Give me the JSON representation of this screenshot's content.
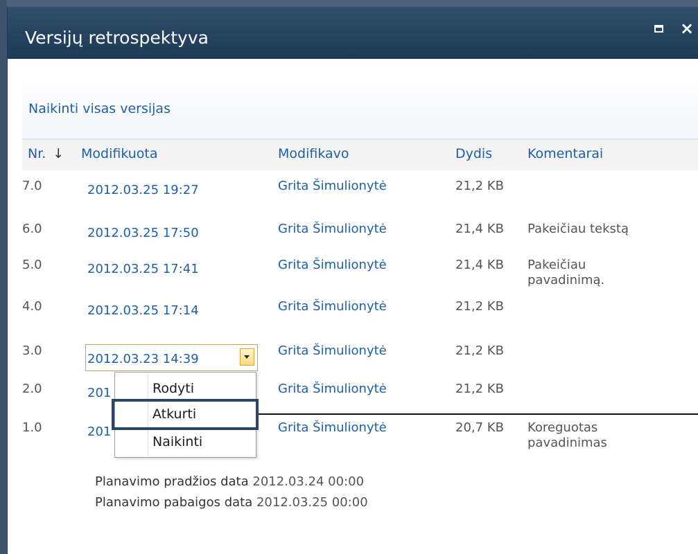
{
  "dialog": {
    "title": "Versijų retrospektyva"
  },
  "toolbar": {
    "delete_all_label": "Naikinti visas versijas"
  },
  "columns": {
    "number": "Nr.",
    "sort_indicator": "↓",
    "modified": "Modifikuota",
    "modified_by": "Modifikavo",
    "size": "Dydis",
    "comments": "Komentarai"
  },
  "versions": [
    {
      "number": "7.0",
      "modified": "2012.03.25 19:27",
      "author": "Grita Šimulionytė",
      "size": "21,2 KB",
      "comment": ""
    },
    {
      "number": "6.0",
      "modified": "2012.03.25 17:50",
      "author": "Grita Šimulionytė",
      "size": "21,4 KB",
      "comment": "Pakeičiau tekstą"
    },
    {
      "number": "5.0",
      "modified": "2012.03.25 17:41",
      "author": "Grita Šimulionytė",
      "size": "21,4 KB",
      "comment": "Pakeičiau pavadinimą."
    },
    {
      "number": "4.0",
      "modified": "2012.03.25 17:14",
      "author": "Grita Šimulionytė",
      "size": "21,2 KB",
      "comment": ""
    },
    {
      "number": "3.0",
      "modified": "2012.03.23 14:39",
      "author": "Grita Šimulionytė",
      "size": "21,2 KB",
      "comment": ""
    },
    {
      "number": "2.0",
      "modified": "201",
      "author": "Grita Šimulionytė",
      "size": "21,2 KB",
      "comment": ""
    },
    {
      "number": "1.0",
      "modified": "201",
      "author": "Grita Šimulionytė",
      "size": "20,7 KB",
      "comment": "Koreguotas pavadinimas"
    }
  ],
  "context_menu": {
    "items": [
      "Rodyti",
      "Atkurti",
      "Naikinti"
    ],
    "highlighted": "Atkurti"
  },
  "schedule": {
    "start_label": "Planavimo pradžios data",
    "start_value": "2012.03.24 00:00",
    "end_label": "Planavimo pabaigos data",
    "end_value": "2012.03.25 00:00"
  },
  "colors": {
    "link": "#1e5fa8",
    "titlebar": "#1c3956",
    "highlight_border": "#2b4766"
  },
  "icons": {
    "maximize": "maximize-icon",
    "close": "close-icon",
    "dropdown": "chevron-down-icon"
  }
}
